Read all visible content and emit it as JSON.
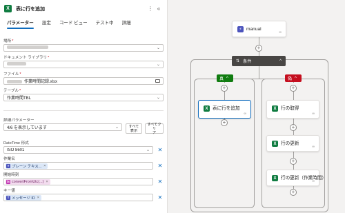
{
  "panel": {
    "title": "表に行を追加",
    "icon": "excel-icon",
    "more": "⋮",
    "collapse": "«",
    "tabs": [
      "パラメーター",
      "設定",
      "コード ビュー",
      "テスト中",
      "詳細"
    ],
    "location_label": "場所",
    "library_label": "ドキュメント ライブラリ",
    "file_label": "ファイル",
    "file_value": "作業時間記録.xlsx",
    "table_label": "テーブル",
    "table_value": "作業時間TBL",
    "required_mark": "*",
    "advanced_label": "詳細パラメーター",
    "advanced_value": "4/6 を表示しています",
    "show_all_1": "すべて",
    "show_all_2": "表示",
    "clear_all_1": "すべてクリ",
    "clear_all_2": "ア",
    "datetime_label": "DateTime 形式",
    "datetime_value": "ISO 8601",
    "work_label": "作業名",
    "work_chip": "プレーン テキス...",
    "start_label": "開始時刻",
    "start_chip": "convertFromUtc(...)",
    "key_label": "キー値",
    "key_chip": "メッセージ ID",
    "close_glyph": "✕",
    "chip_close": "×"
  },
  "canvas": {
    "trigger_label": "manual",
    "condition_label": "条件",
    "yes_label": "真",
    "no_label": "偽",
    "yes_action": "表に行を追加",
    "no_actions": [
      "行の取得",
      "行の更新",
      "行の更新（作業時間）"
    ],
    "link_glyph": "∞",
    "plus_glyph": "+",
    "collapse_glyph": "^"
  },
  "colors": {
    "accent": "#0f6cbd",
    "excel": "#107c41",
    "teams": "#4b53bc",
    "yes": "#107c10",
    "no": "#c50f1f",
    "condition_header": "#484644"
  }
}
